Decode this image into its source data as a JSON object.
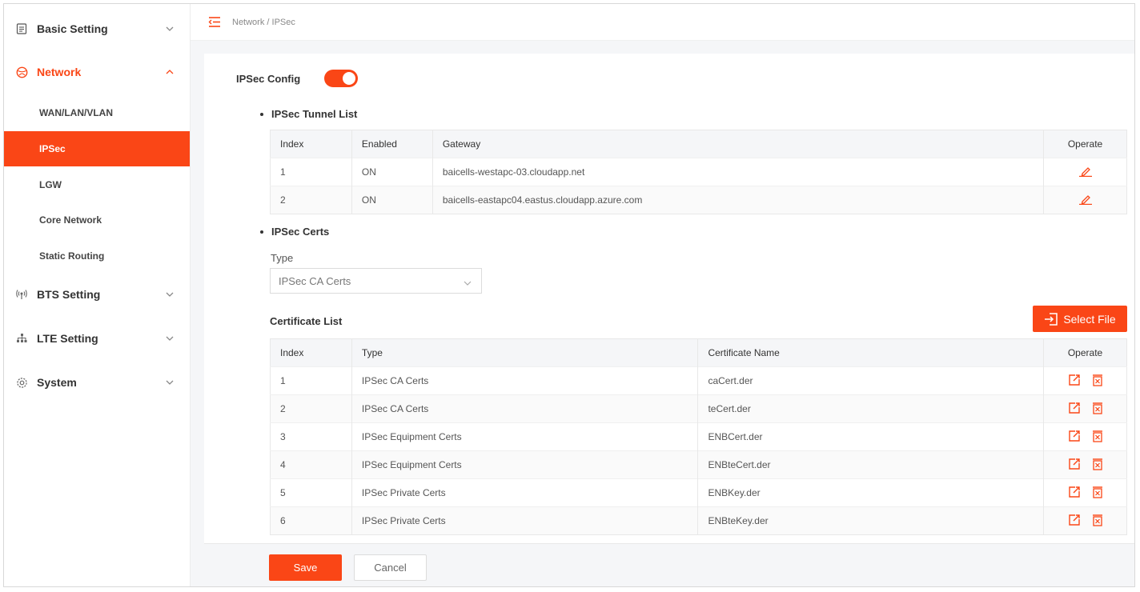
{
  "sidebar": {
    "basic_setting": "Basic Setting",
    "network": "Network",
    "network_items": [
      "WAN/LAN/VLAN",
      "IPSec",
      "LGW",
      "Core Network",
      "Static Routing"
    ],
    "bts_setting": "BTS Setting",
    "lte_setting": "LTE Setting",
    "system": "System"
  },
  "header": {
    "breadcrumb": "Network / IPSec"
  },
  "ipsec_config": {
    "label": "IPSec Config",
    "enabled": true
  },
  "tunnel_list": {
    "title": "IPSec Tunnel List",
    "headers": [
      "Index",
      "Enabled",
      "Gateway",
      "Operate"
    ],
    "rows": [
      [
        "1",
        "ON",
        "baicells-westapc-03.cloudapp.net"
      ],
      [
        "2",
        "ON",
        "baicells-eastapc04.eastus.cloudapp.azure.com"
      ]
    ]
  },
  "certs": {
    "title": "IPSec Certs",
    "type_label": "Type",
    "type_value": "IPSec CA Certs",
    "list_title": "Certificate List",
    "select_file": "Select File",
    "headers": [
      "Index",
      "Type",
      "Certificate Name",
      "Operate"
    ],
    "rows": [
      [
        "1",
        "IPSec CA Certs",
        "caCert.der"
      ],
      [
        "2",
        "IPSec CA Certs",
        "teCert.der"
      ],
      [
        "3",
        "IPSec Equipment Certs",
        "ENBCert.der"
      ],
      [
        "4",
        "IPSec Equipment Certs",
        "ENBteCert.der"
      ],
      [
        "5",
        "IPSec Private Certs",
        "ENBKey.der"
      ],
      [
        "6",
        "IPSec Private Certs",
        "ENBteKey.der"
      ]
    ]
  },
  "footer": {
    "save": "Save",
    "cancel": "Cancel"
  },
  "colors": {
    "accent": "#fa4616"
  },
  "icons": {
    "basic_setting": "document-icon",
    "network": "globe-icon",
    "bts_setting": "antenna-icon",
    "lte_setting": "network-tree-icon",
    "system": "gear-icon"
  }
}
